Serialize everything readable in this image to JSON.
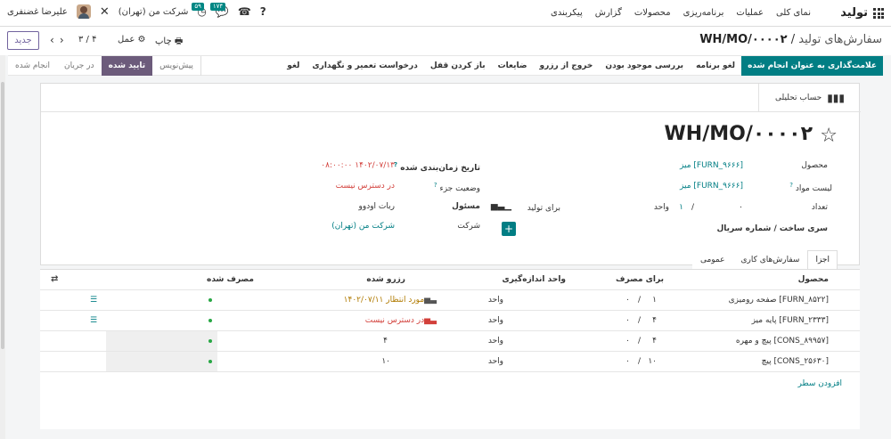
{
  "topbar": {
    "app_title": "تولید",
    "menu": [
      "نمای کلی",
      "عملیات",
      "برنامه‌ریزی",
      "محصولات",
      "گزارش",
      "پیکربندی"
    ],
    "user_name": "علیرضا غضنفری",
    "company": "شرکت من (تهران)",
    "badge_activity": "۵۹",
    "badge_messages": "۱۷۴"
  },
  "control": {
    "breadcrumb_parent": "سفارش‌های تولید",
    "breadcrumb_sep": "/",
    "breadcrumb_current": "WH/MO/۰۰۰۰۲",
    "print_label": "چاپ",
    "action_label": "عمل",
    "pager": "۳ / ۴",
    "new_label": "جدید"
  },
  "statusbar": {
    "actions": [
      "علامت‌گذاری به عنوان انجام شده",
      "لغو برنامه",
      "بررسی موجود بودن",
      "خروج از رزرو",
      "ضایعات",
      "باز کردن قفل",
      "درخواست تعمیر و نگهداری",
      "لغو"
    ],
    "stages": [
      "پیش‌نویس",
      "تایید شده",
      "در جریان",
      "انجام شده"
    ],
    "active_stage_index": 1
  },
  "sheet": {
    "smart_button": "حساب تحلیلی",
    "title": "WH/MO/۰۰۰۰۲",
    "fields": {
      "product_label": "محصول",
      "product_value": "[FURN_۹۶۶۶] میز",
      "bom_label": "لیست مواد",
      "bom_value": "[FURN_۹۶۶۶] میز",
      "qty_label": "تعداد",
      "qty_produced": "۰",
      "qty_sep": "/",
      "qty_total": "۱",
      "qty_unit": "واحد",
      "to_produce_label": "برای تولید",
      "lot_label": "سری ساخت / شماره سریال",
      "scheduled_label": "تاریخ زمان‌بندی شده",
      "scheduled_value": "۱۴۰۲/۰۷/۱۳ ۰۸:۰۰:۰۰",
      "component_status_label": "وضعیت جزء",
      "component_status_value": "در دسترس نیست",
      "responsible_label": "مسئول",
      "responsible_value": "ربات اودوو",
      "company_label": "شرکت",
      "company_value": "شرکت من (تهران)"
    }
  },
  "tabs": [
    "اجزا",
    "سفارش‌های کاری",
    "عمومی"
  ],
  "table": {
    "headers": {
      "product": "محصول",
      "to_consume": "برای مصرف",
      "uom": "واحد اندازه‌گیری",
      "reserved": "رزرو شده",
      "consumed": "مصرف شده"
    },
    "rows": [
      {
        "product": "[FURN_۸۵۲۲] صفحه رومیزی",
        "to_consume": "۱",
        "consumed_left": "۰",
        "uom": "واحد",
        "reserved": "مورد انتظار ۱۴۰۲/۰۷/۱۱",
        "reserved_style": "warn",
        "has_list": true,
        "gray": false
      },
      {
        "product": "[FURN_۲۳۳۳] پایه میز",
        "to_consume": "۴",
        "consumed_left": "۰",
        "uom": "واحد",
        "reserved": "در دسترس نیست",
        "reserved_style": "red",
        "has_list": true,
        "gray": false
      },
      {
        "product": "[CONS_۸۹۹۵۷] پیچ و مهره",
        "to_consume": "۴",
        "consumed_left": "۰",
        "uom": "واحد",
        "reserved": "۴",
        "reserved_style": "plain",
        "has_list": false,
        "gray": true
      },
      {
        "product": "[CONS_۲۵۶۳۰] پیچ",
        "to_consume": "۱۰",
        "consumed_left": "۰",
        "uom": "واحد",
        "reserved": "۱۰",
        "reserved_style": "plain",
        "has_list": false,
        "gray": true
      }
    ],
    "add_line": "افزودن سطر"
  }
}
